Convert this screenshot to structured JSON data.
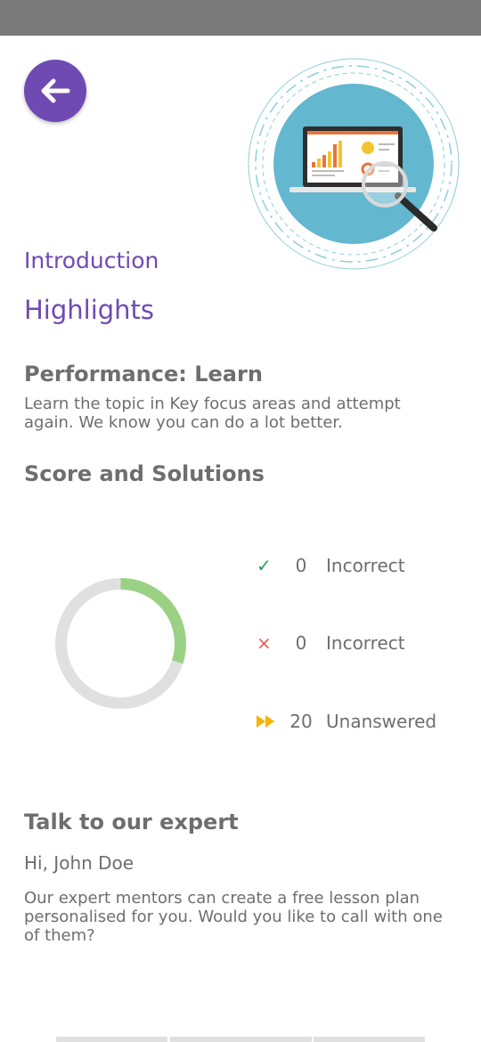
{
  "header": {
    "back_icon": "arrow-left-icon"
  },
  "hero": {
    "icon": "laptop-analytics-magnifier-illustration"
  },
  "sections": {
    "introduction": "Introduction",
    "highlights": "Highlights"
  },
  "performance": {
    "title": "Performance: Learn",
    "text": "Learn the topic in Key focus areas and attempt again. We know you can do a lot better."
  },
  "score": {
    "title": "Score and Solutions",
    "ring_fill_fraction": 0.3,
    "ring_color": "#9bd184",
    "ring_track_color": "#e0e0e0",
    "stats": [
      {
        "icon": "check-icon",
        "value": "0",
        "label": "Incorrect",
        "color": "#2a9d5c"
      },
      {
        "icon": "cross-icon",
        "value": "0",
        "label": "Incorrect",
        "color": "#e85c5c"
      },
      {
        "icon": "fast-forward-icon",
        "value": "20",
        "label": "Unanswered",
        "color": "#f4b400"
      }
    ]
  },
  "expert": {
    "title": "Talk to our expert",
    "greeting": "Hi, John Doe",
    "text": "Our expert mentors can create a free lesson plan personalised for you. Would you like to call with one of them?"
  }
}
